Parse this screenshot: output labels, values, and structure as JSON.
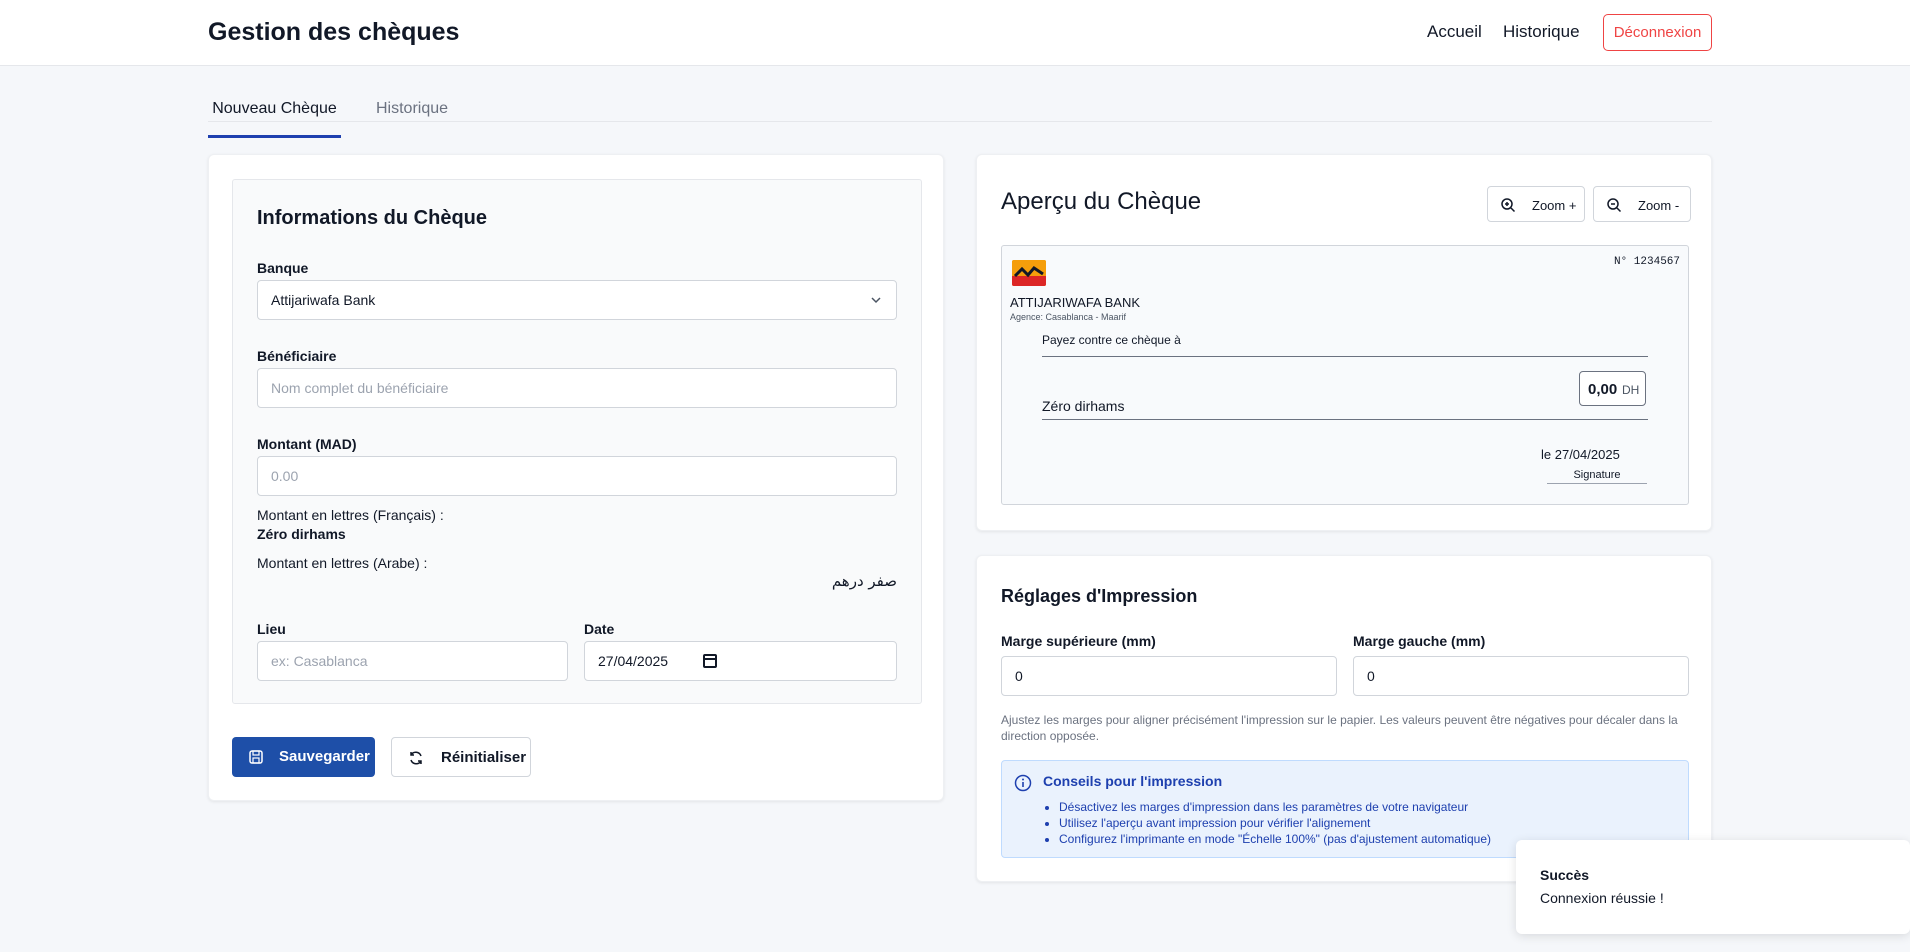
{
  "header": {
    "title": "Gestion des chèques",
    "nav": {
      "home": "Accueil",
      "history": "Historique",
      "logout": "Déconnexion"
    }
  },
  "tabs": [
    {
      "label": "Nouveau Chèque",
      "active": true
    },
    {
      "label": "Historique",
      "active": false
    }
  ],
  "form": {
    "section_title": "Informations du Chèque",
    "bank_label": "Banque",
    "bank_value": "Attijariwafa Bank",
    "beneficiary_label": "Bénéficiaire",
    "beneficiary_placeholder": "Nom complet du bénéficiaire",
    "amount_label": "Montant (MAD)",
    "amount_placeholder": "0.00",
    "words_fr_label": "Montant en lettres (Français) :",
    "words_fr_value": "Zéro dirhams",
    "words_ar_label": "Montant en lettres (Arabe) :",
    "words_ar_value": "صفر درهم",
    "place_label": "Lieu",
    "place_placeholder": "ex: Casablanca",
    "date_label": "Date",
    "date_value": "27/04/2025",
    "save_label": "Sauvegarder",
    "reset_label": "Réinitialiser"
  },
  "preview": {
    "title": "Aperçu du Chèque",
    "zoom_in_label": "Zoom +",
    "zoom_out_label": "Zoom -",
    "cheque": {
      "number": "N° 1234567",
      "bank_name": "ATTIJARIWAFA BANK",
      "agency": "Agence: Casablanca - Maarif",
      "pay_to_label": "Payez contre ce chèque à",
      "amount": "0,00",
      "currency": "DH",
      "amount_words": "Zéro dirhams",
      "date_line": "le 27/04/2025",
      "signature_label": "Signature"
    }
  },
  "print": {
    "title": "Réglages d'Impression",
    "top_margin_label": "Marge supérieure (mm)",
    "top_margin_value": "0",
    "left_margin_label": "Marge gauche (mm)",
    "left_margin_value": "0",
    "help_text": "Ajustez les marges pour aligner précisément l'impression sur le papier. Les valeurs peuvent être négatives pour décaler dans la direction opposée.",
    "tips_title": "Conseils pour l'impression",
    "tips": [
      "Désactivez les marges d'impression dans les paramètres de votre navigateur",
      "Utilisez l'aperçu avant impression pour vérifier l'alignement",
      "Configurez l'imprimante en mode \"Échelle 100%\" (pas d'ajustement automatique)"
    ]
  },
  "toast": {
    "title": "Succès",
    "message": "Connexion réussie !"
  },
  "colors": {
    "primary": "#1e4fa8",
    "danger": "#ef4444",
    "info_bg": "#eaf2fd",
    "info_text": "#1e40af"
  },
  "icons": [
    "chevron-down-icon",
    "calendar-icon",
    "save-icon",
    "refresh-icon",
    "zoom-in-icon",
    "zoom-out-icon",
    "bank-logo-icon",
    "info-icon"
  ]
}
